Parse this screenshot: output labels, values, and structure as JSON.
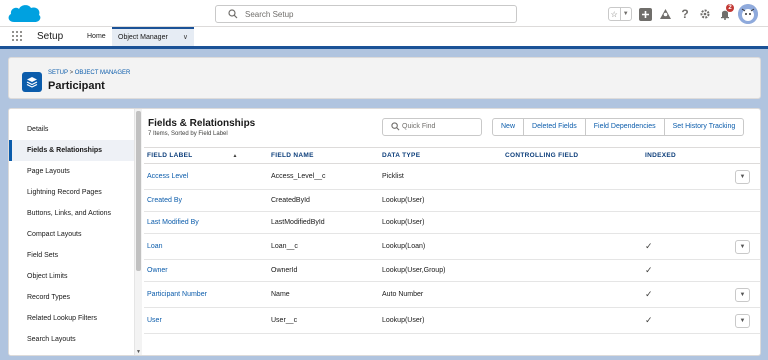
{
  "header": {
    "search_placeholder": "Search Setup",
    "notification_count": "2"
  },
  "context": {
    "app_name": "Setup",
    "tabs": [
      {
        "label": "Home"
      },
      {
        "label": "Object Manager"
      }
    ]
  },
  "page": {
    "breadcrumb": "SETUP > OBJECT MANAGER",
    "breadcrumb_setup": "SETUP",
    "breadcrumb_sep": " > ",
    "breadcrumb_om": "OBJECT MANAGER",
    "title": "Participant"
  },
  "sidebar": {
    "items": [
      {
        "label": "Details"
      },
      {
        "label": "Fields & Relationships"
      },
      {
        "label": "Page Layouts"
      },
      {
        "label": "Lightning Record Pages"
      },
      {
        "label": "Buttons, Links, and Actions"
      },
      {
        "label": "Compact Layouts"
      },
      {
        "label": "Field Sets"
      },
      {
        "label": "Object Limits"
      },
      {
        "label": "Record Types"
      },
      {
        "label": "Related Lookup Filters"
      },
      {
        "label": "Search Layouts"
      }
    ]
  },
  "main": {
    "title": "Fields & Relationships",
    "subtitle": "7 Items, Sorted by Field Label",
    "quick_find_placeholder": "Quick Find",
    "buttons": {
      "new": "New",
      "deleted_fields": "Deleted Fields",
      "field_dependencies": "Field Dependencies",
      "history_tracking": "Set History Tracking"
    },
    "columns": {
      "field_label": "FIELD LABEL",
      "field_name": "FIELD NAME",
      "data_type": "DATA TYPE",
      "controlling_field": "CONTROLLING FIELD",
      "indexed": "INDEXED"
    },
    "rows": [
      {
        "label": "Access Level",
        "name": "Access_Level__c",
        "type": "Picklist",
        "controlling": "",
        "indexed": ""
      },
      {
        "label": "Created By",
        "name": "CreatedById",
        "type": "Lookup(User)",
        "controlling": "",
        "indexed": ""
      },
      {
        "label": "Last Modified By",
        "name": "LastModifiedById",
        "type": "Lookup(User)",
        "controlling": "",
        "indexed": ""
      },
      {
        "label": "Loan",
        "name": "Loan__c",
        "type": "Lookup(Loan)",
        "controlling": "",
        "indexed": "✓"
      },
      {
        "label": "Owner",
        "name": "OwnerId",
        "type": "Lookup(User,Group)",
        "controlling": "",
        "indexed": "✓"
      },
      {
        "label": "Participant Number",
        "name": "Name",
        "type": "Auto Number",
        "controlling": "",
        "indexed": "✓"
      },
      {
        "label": "User",
        "name": "User__c",
        "type": "Lookup(User)",
        "controlling": "",
        "indexed": "✓"
      }
    ]
  },
  "colors": {
    "brand": "#0b5cab",
    "nav_bar": "#1b5297",
    "background": "#b0c4df"
  }
}
